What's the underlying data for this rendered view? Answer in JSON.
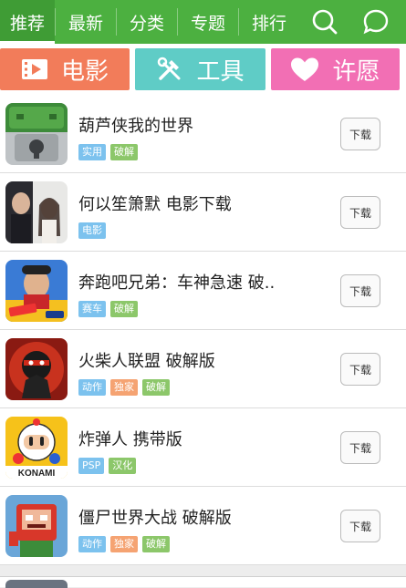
{
  "nav": {
    "tabs": [
      {
        "label": "推荐",
        "active": true
      },
      {
        "label": "最新"
      },
      {
        "label": "分类"
      },
      {
        "label": "专题"
      },
      {
        "label": "排行"
      }
    ],
    "icons": [
      "search-icon",
      "chat-bubble-icon"
    ]
  },
  "categories": [
    {
      "label": "电影",
      "icon": "film-icon",
      "color": "#f27c5a"
    },
    {
      "label": "工具",
      "icon": "tools-icon",
      "color": "#5fccc6"
    },
    {
      "label": "许愿",
      "icon": "heart-icon",
      "color": "#f26fb4"
    }
  ],
  "tag_colors": {
    "blue": "#7cc2ee",
    "green": "#8cc76a",
    "orange": "#f5a372"
  },
  "download_label": "下载",
  "apps": [
    {
      "title": "葫芦侠我的世界",
      "tags": [
        {
          "text": "实用",
          "color": "blue"
        },
        {
          "text": "破解",
          "color": "green"
        }
      ]
    },
    {
      "title": "何以笙箫默  电影下载",
      "tags": [
        {
          "text": "电影",
          "color": "blue"
        }
      ]
    },
    {
      "title": "奔跑吧兄弟：车神急速  破..",
      "tags": [
        {
          "text": "赛车",
          "color": "blue"
        },
        {
          "text": "破解",
          "color": "green"
        }
      ]
    },
    {
      "title": "火柴人联盟  破解版",
      "tags": [
        {
          "text": "动作",
          "color": "blue"
        },
        {
          "text": "独家",
          "color": "orange"
        },
        {
          "text": "破解",
          "color": "green"
        }
      ]
    },
    {
      "title": "炸弹人  携带版",
      "tags": [
        {
          "text": "PSP",
          "color": "blue"
        },
        {
          "text": "汉化",
          "color": "green"
        }
      ]
    },
    {
      "title": "僵尸世界大战  破解版",
      "tags": [
        {
          "text": "动作",
          "color": "blue"
        },
        {
          "text": "独家",
          "color": "orange"
        },
        {
          "text": "破解",
          "color": "green"
        }
      ]
    }
  ],
  "thumb_logo": "KONAMI"
}
